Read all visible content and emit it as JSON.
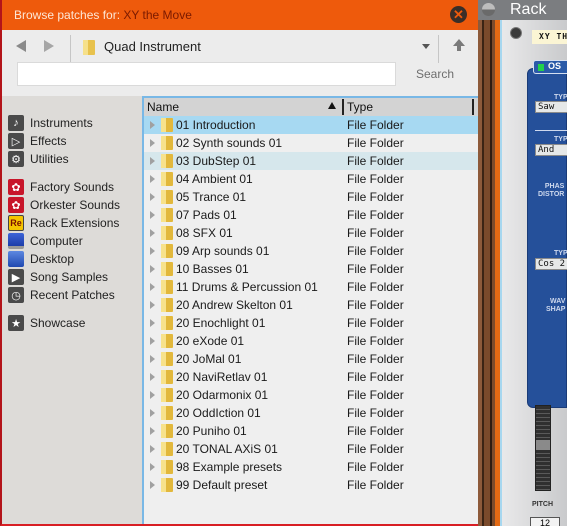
{
  "dialog": {
    "title_prefix": "Browse patches for:",
    "title_device": "XY the Move",
    "close_icon": "close-circle-icon",
    "colors": {
      "titlebar": "#ee5a0c",
      "selection": "#a7d9f2",
      "accent_border": "#79b8e6"
    }
  },
  "toolbar": {
    "back_icon": "back-arrow-icon",
    "forward_icon": "forward-arrow-icon",
    "path_label": "Quad Instrument",
    "path_icon": "folder-icon",
    "up_icon": "up-arrow-icon",
    "search_value": "",
    "search_placeholder": "",
    "search_label": "Search"
  },
  "sidebar": {
    "groups": [
      [
        {
          "label": "Instruments",
          "icon": "instruments-icon"
        },
        {
          "label": "Effects",
          "icon": "effects-icon"
        },
        {
          "label": "Utilities",
          "icon": "utilities-icon"
        }
      ],
      [
        {
          "label": "Factory Sounds",
          "icon": "soundbank-icon"
        },
        {
          "label": "Orkester Sounds",
          "icon": "soundbank-icon"
        },
        {
          "label": "Rack Extensions",
          "icon": "rack-extensions-icon"
        },
        {
          "label": "Computer",
          "icon": "computer-icon"
        },
        {
          "label": "Desktop",
          "icon": "desktop-icon"
        },
        {
          "label": "Song Samples",
          "icon": "song-samples-icon"
        },
        {
          "label": "Recent Patches",
          "icon": "clock-icon"
        }
      ],
      [
        {
          "label": "Showcase",
          "icon": "star-icon"
        }
      ]
    ]
  },
  "filelist": {
    "columns": {
      "name": "Name",
      "type": "Type",
      "sort": "ascending"
    },
    "rows": [
      {
        "name": "01 Introduction",
        "type": "File Folder",
        "state": "selected"
      },
      {
        "name": "02 Synth sounds 01",
        "type": "File Folder",
        "state": ""
      },
      {
        "name": "03 DubStep 01",
        "type": "File Folder",
        "state": "hover"
      },
      {
        "name": "04 Ambient 01",
        "type": "File Folder",
        "state": ""
      },
      {
        "name": "05 Trance 01",
        "type": "File Folder",
        "state": ""
      },
      {
        "name": "07 Pads 01",
        "type": "File Folder",
        "state": ""
      },
      {
        "name": "08 SFX 01",
        "type": "File Folder",
        "state": ""
      },
      {
        "name": "09 Arp sounds 01",
        "type": "File Folder",
        "state": ""
      },
      {
        "name": "10 Basses 01",
        "type": "File Folder",
        "state": ""
      },
      {
        "name": "11 Drums & Percussion 01",
        "type": "File Folder",
        "state": ""
      },
      {
        "name": "20 Andrew Skelton 01",
        "type": "File Folder",
        "state": ""
      },
      {
        "name": "20 Enochlight 01",
        "type": "File Folder",
        "state": ""
      },
      {
        "name": "20 eXode 01",
        "type": "File Folder",
        "state": ""
      },
      {
        "name": "20 JoMal 01",
        "type": "File Folder",
        "state": ""
      },
      {
        "name": "20 NaviRetlav 01",
        "type": "File Folder",
        "state": ""
      },
      {
        "name": "20 Odarmonix 01",
        "type": "File Folder",
        "state": ""
      },
      {
        "name": "20 OddIction 01",
        "type": "File Folder",
        "state": ""
      },
      {
        "name": "20 Puniho 01",
        "type": "File Folder",
        "state": ""
      },
      {
        "name": "20 TONAL AXiS 01",
        "type": "File Folder",
        "state": ""
      },
      {
        "name": "98 Example presets",
        "type": "File Folder",
        "state": ""
      },
      {
        "name": "99 Default preset",
        "type": "File Folder",
        "state": ""
      }
    ]
  },
  "rack": {
    "title": "Rack",
    "device_name": "XY TH",
    "osc_label": "OS",
    "type_label_1": "TYP",
    "type_value_1": "Saw",
    "type_label_2": "TYP",
    "type_value_2": "And",
    "phase_label": "PHAS\nDISTOR",
    "type_label_3": "TYP",
    "type_value_3": "Cos 2",
    "wave_label": "WAV\nSHAP",
    "pitch_label": "PITCH",
    "pitch_value": "12"
  }
}
